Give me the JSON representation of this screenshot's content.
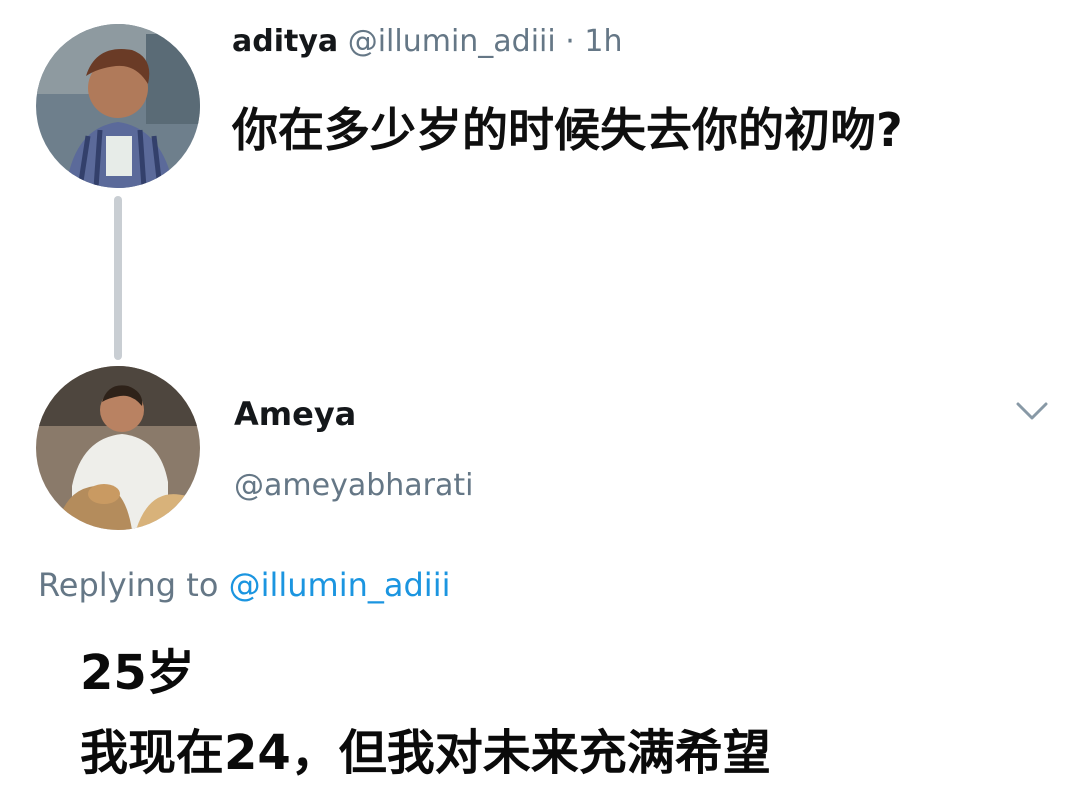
{
  "original_tweet": {
    "display_name": "aditya",
    "handle": "@illumin_adiii",
    "separator": "·",
    "time": "1h",
    "text": "你在多少岁的时候失去你的初吻?"
  },
  "reply": {
    "display_name": "Ameya",
    "handle": "@ameyabharati",
    "replying_prefix": "Replying to",
    "replying_handle": "@illumin_adiii",
    "lines": [
      "25岁",
      "我现在24，但我对未来充满希望"
    ]
  },
  "icons": {
    "menu": "chevron-down-icon"
  },
  "colors": {
    "secondary_text": "#657786",
    "link": "#1b95e0",
    "thread_line": "#c9ced3"
  }
}
